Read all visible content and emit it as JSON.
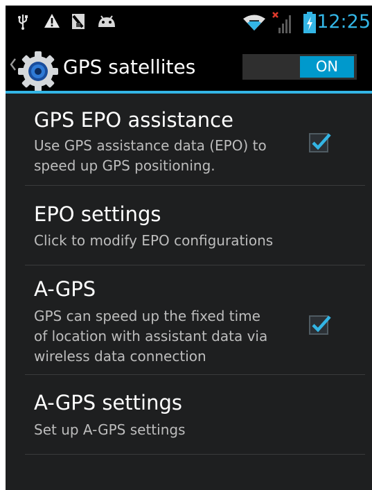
{
  "status_bar": {
    "time": "12:25",
    "icons": [
      "usb-icon",
      "warning-icon",
      "sd-card-icon",
      "android-icon",
      "wifi-icon",
      "no-signal-icon",
      "battery-charging-icon"
    ]
  },
  "action_bar": {
    "title": "GPS satellites",
    "switch_label": "ON",
    "switch_on": true,
    "accent_color": "#33b5e5"
  },
  "preferences": [
    {
      "title": "GPS EPO assistance",
      "summary": [
        "Use GPS assistance data (EPO) to",
        "speed up GPS positioning."
      ],
      "checked": true
    },
    {
      "title": "EPO settings",
      "summary": [
        "Click to modify EPO configurations"
      ]
    },
    {
      "title": "A-GPS",
      "summary": [
        "GPS can speed up the fixed time",
        "of location with assistant data via",
        "wireless data connection"
      ],
      "checked": true
    },
    {
      "title": "A-GPS settings",
      "summary": [
        "Set up A-GPS settings"
      ]
    }
  ]
}
